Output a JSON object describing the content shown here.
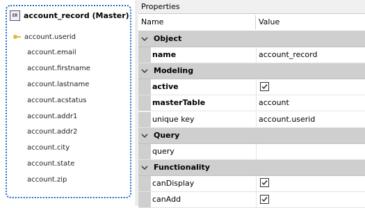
{
  "table": {
    "title": "account_record (Master)",
    "icon": "table-icon",
    "columns": [
      {
        "name": "account.userid",
        "key": true
      },
      {
        "name": "account.email",
        "key": false
      },
      {
        "name": "account.firstname",
        "key": false
      },
      {
        "name": "account.lastname",
        "key": false
      },
      {
        "name": "account.acstatus",
        "key": false
      },
      {
        "name": "account.addr1",
        "key": false
      },
      {
        "name": "account.addr2",
        "key": false
      },
      {
        "name": "account.city",
        "key": false
      },
      {
        "name": "account.state",
        "key": false
      },
      {
        "name": "account.zip",
        "key": false
      }
    ]
  },
  "properties": {
    "title": "Properties",
    "header": {
      "name": "Name",
      "value": "Value"
    },
    "rows": [
      {
        "type": "category",
        "label": "Object"
      },
      {
        "type": "prop",
        "name": "name",
        "bold": true,
        "value": "account_record"
      },
      {
        "type": "category",
        "label": "Modeling"
      },
      {
        "type": "prop",
        "name": "active",
        "bold": true,
        "checkbox": true,
        "checked": true
      },
      {
        "type": "prop",
        "name": "masterTable",
        "bold": true,
        "value": "account"
      },
      {
        "type": "prop",
        "name": "unique key",
        "bold": false,
        "value": "account.userid"
      },
      {
        "type": "category",
        "label": "Query"
      },
      {
        "type": "prop",
        "name": "query",
        "bold": false,
        "value": ""
      },
      {
        "type": "category",
        "label": "Functionality"
      },
      {
        "type": "prop",
        "name": "canDisplay",
        "bold": false,
        "checkbox": true,
        "checked": true
      },
      {
        "type": "prop",
        "name": "canAdd",
        "bold": false,
        "checkbox": true,
        "checked": true
      }
    ]
  },
  "colors": {
    "selection_border": "#1f6cc4",
    "category_bg": "#cfcfcf",
    "key_icon": "#e3b53b"
  }
}
